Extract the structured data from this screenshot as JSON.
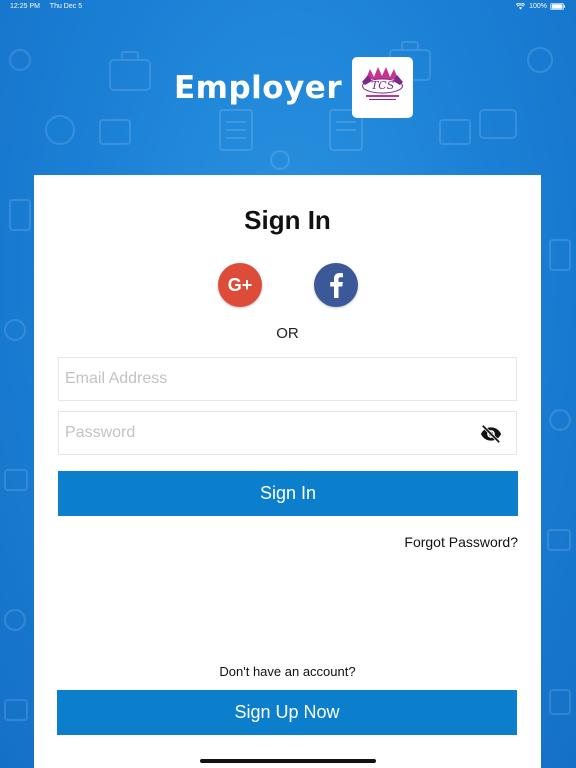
{
  "status_bar": {
    "time": "12:25 PM",
    "date": "Thu Dec 5",
    "battery": "100%"
  },
  "brand": {
    "title": "Employer",
    "logo_text": "TCS"
  },
  "signin": {
    "title": "Sign In",
    "google_label": "G+",
    "facebook_label": "f",
    "or_label": "OR",
    "email_placeholder": "Email Address",
    "password_placeholder": "Password",
    "submit_label": "Sign In",
    "forgot_label": "Forgot Password?"
  },
  "signup": {
    "prompt": "Don't have an account?",
    "button_label": "Sign Up Now"
  },
  "colors": {
    "background": "#1a7fd4",
    "primary_button": "#0b7fcb",
    "google": "#dd4b39",
    "facebook": "#3b5998"
  }
}
